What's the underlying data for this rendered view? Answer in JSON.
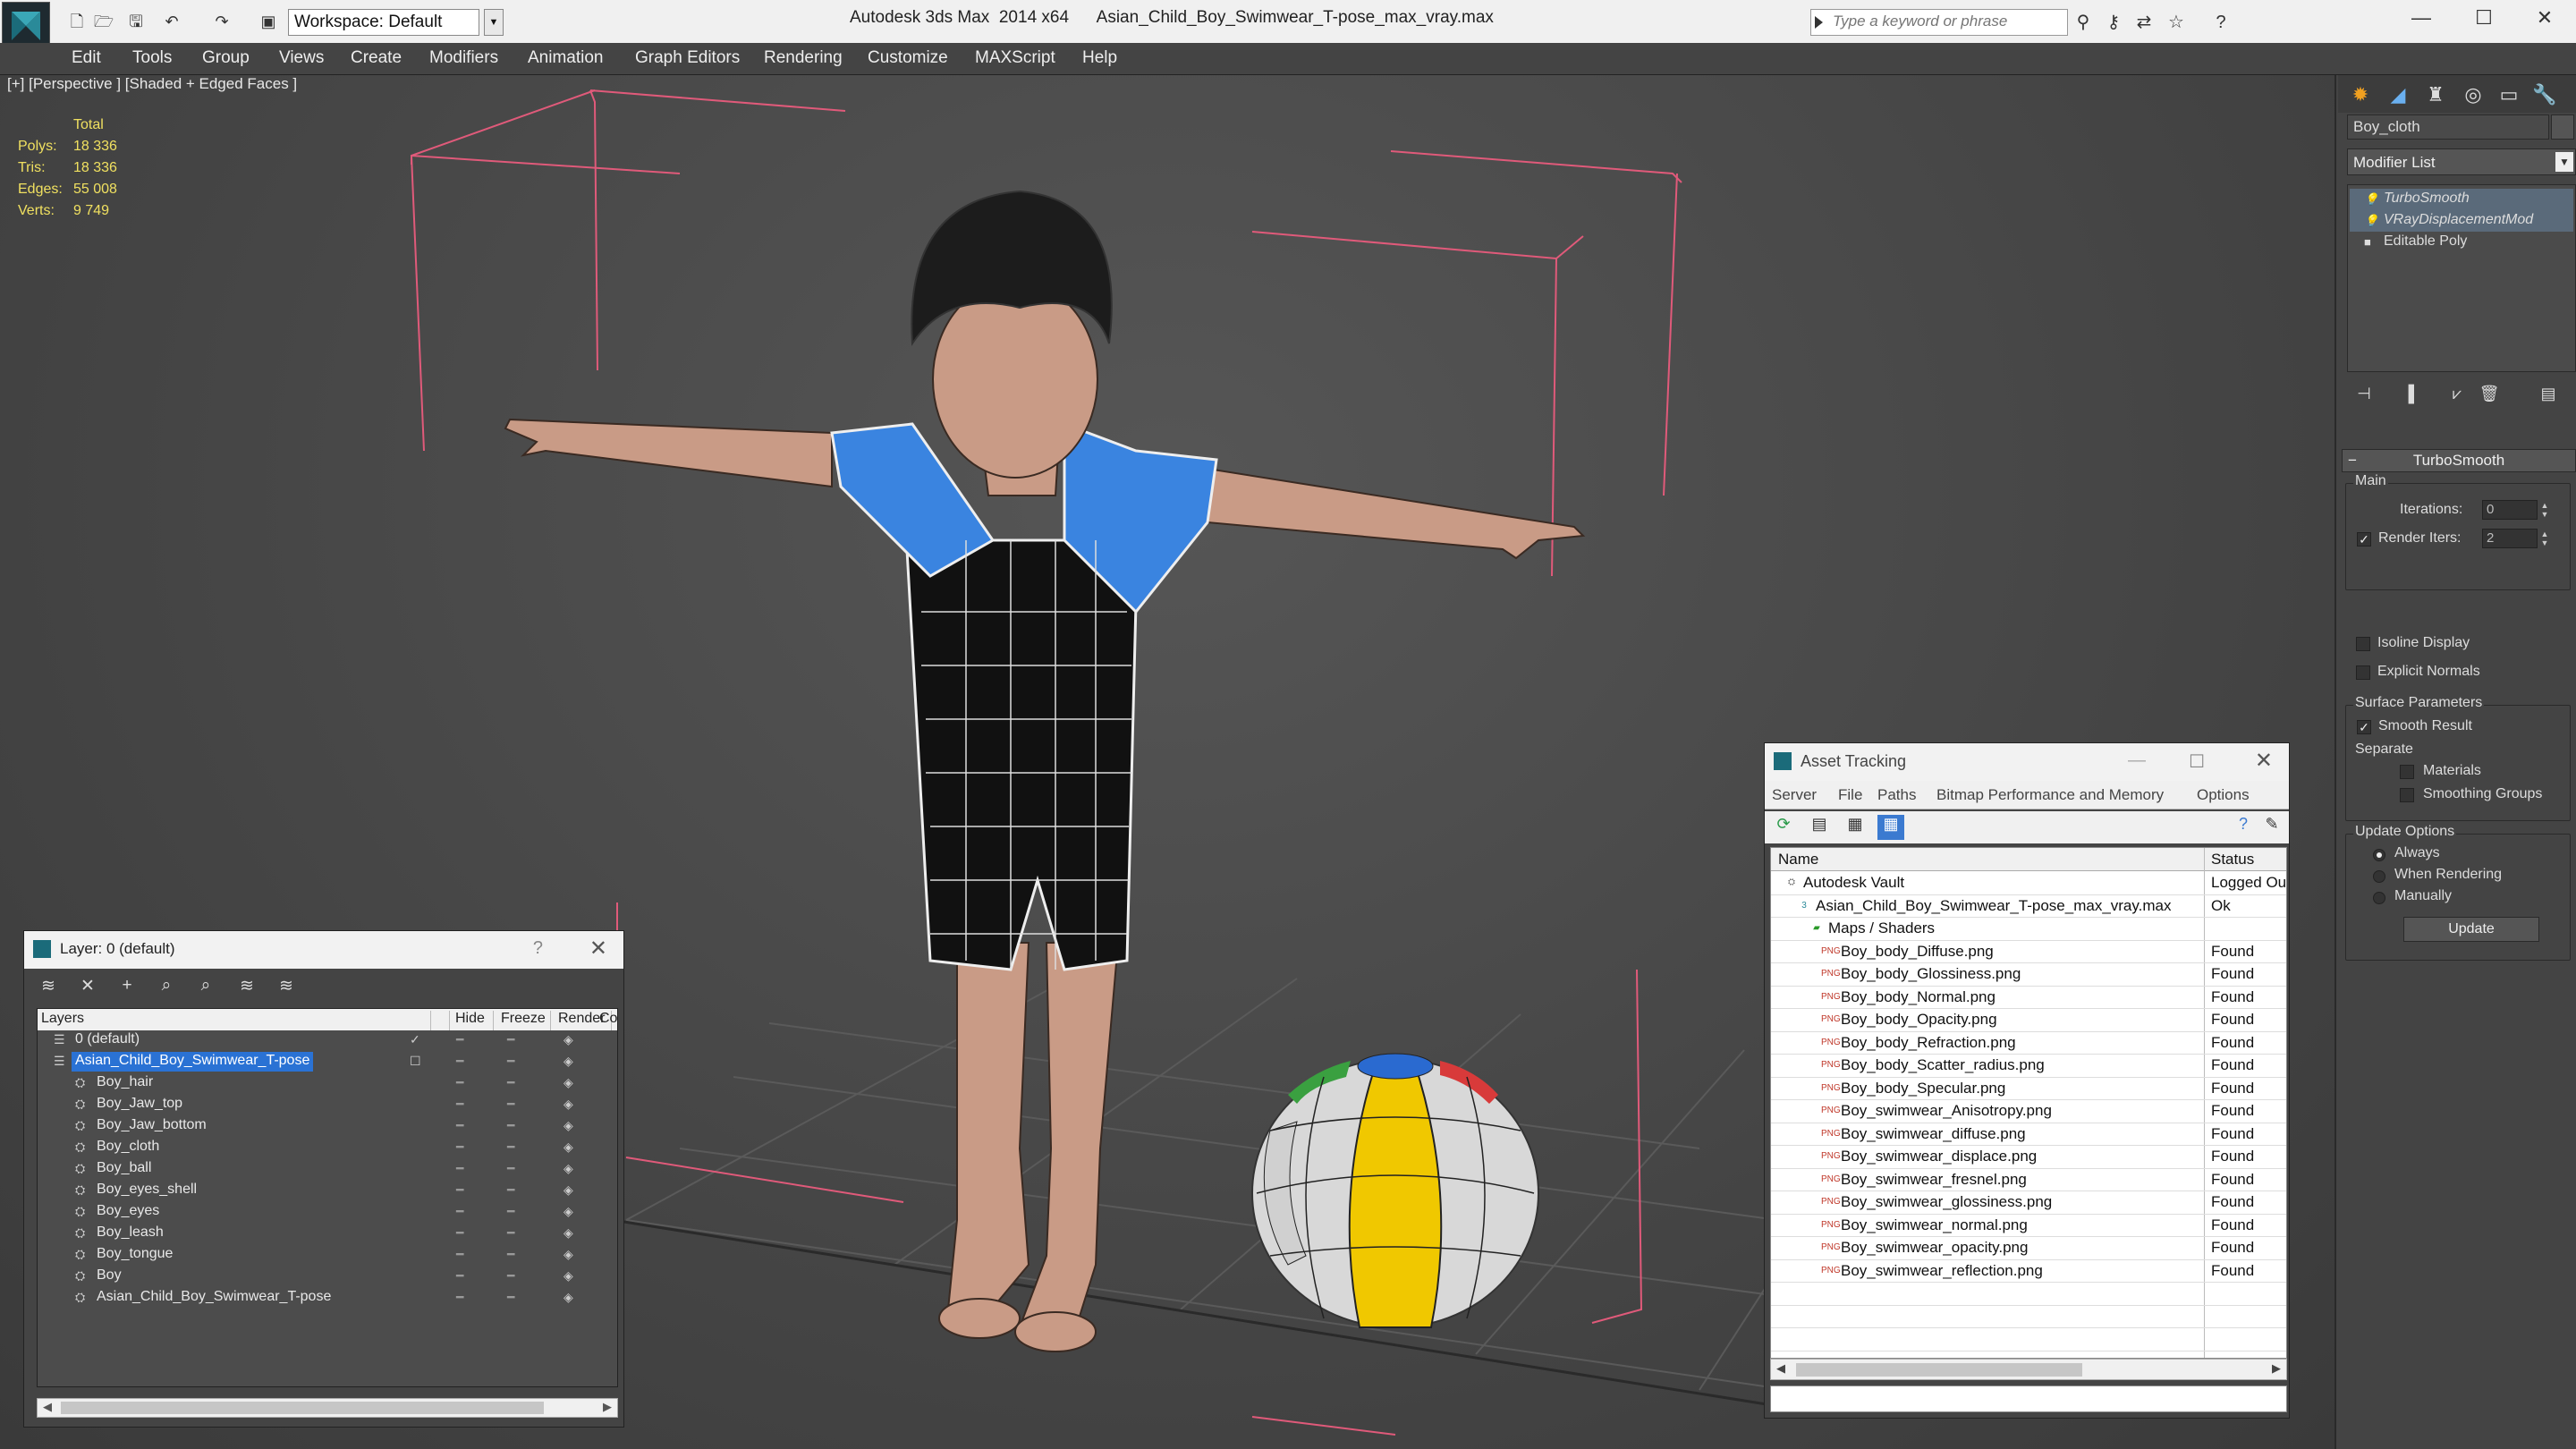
{
  "titlebar": {
    "workspace": "Workspace: Default",
    "app_title": "Autodesk 3ds Max  2014 x64      Asian_Child_Boy_Swimwear_T-pose_max_vray.max",
    "search_placeholder": "Type a keyword or phrase"
  },
  "menu": [
    "Edit",
    "Tools",
    "Group",
    "Views",
    "Create",
    "Modifiers",
    "Animation",
    "Graph Editors",
    "Rendering",
    "Customize",
    "MAXScript",
    "Help"
  ],
  "viewport": {
    "label": "[+] [Perspective ] [Shaded + Edged Faces ]",
    "stats_header": "Total",
    "stats": [
      {
        "k": "Polys:",
        "v": "18 336"
      },
      {
        "k": "Tris:",
        "v": "18 336"
      },
      {
        "k": "Edges:",
        "v": "55 008"
      },
      {
        "k": "Verts:",
        "v": "9 749"
      }
    ]
  },
  "command_panel": {
    "object_name": "Boy_cloth",
    "modifier_list": "Modifier List",
    "stack": [
      "TurboSmooth",
      "VRayDisplacementMod",
      "Editable Poly"
    ],
    "turbosmooth": {
      "title": "TurboSmooth",
      "main": "Main",
      "iterations_label": "Iterations:",
      "iterations": "0",
      "render_iters_label": "Render Iters:",
      "render_iters": "2",
      "isoline": "Isoline Display",
      "explicit_normals": "Explicit Normals",
      "surface_params": "Surface Parameters",
      "smooth_result": "Smooth Result",
      "separate": "Separate",
      "materials": "Materials",
      "smoothing_groups": "Smoothing Groups",
      "update_options": "Update Options",
      "always": "Always",
      "when_rendering": "When Rendering",
      "manually": "Manually",
      "update_button": "Update"
    }
  },
  "layer_dialog": {
    "title": "Layer: 0 (default)",
    "columns": [
      "Layers",
      "Hide",
      "Freeze",
      "Render",
      "Co"
    ],
    "rows": [
      {
        "name": "0 (default)",
        "level": 0
      },
      {
        "name": "Asian_Child_Boy_Swimwear_T-pose",
        "level": 0,
        "selected": true
      },
      {
        "name": "Boy_hair",
        "level": 1
      },
      {
        "name": "Boy_Jaw_top",
        "level": 1
      },
      {
        "name": "Boy_Jaw_bottom",
        "level": 1
      },
      {
        "name": "Boy_cloth",
        "level": 1
      },
      {
        "name": "Boy_ball",
        "level": 1
      },
      {
        "name": "Boy_eyes_shell",
        "level": 1
      },
      {
        "name": "Boy_eyes",
        "level": 1
      },
      {
        "name": "Boy_leash",
        "level": 1
      },
      {
        "name": "Boy_tongue",
        "level": 1
      },
      {
        "name": "Boy",
        "level": 1
      },
      {
        "name": "Asian_Child_Boy_Swimwear_T-pose",
        "level": 1
      }
    ]
  },
  "asset_dialog": {
    "title": "Asset Tracking",
    "menu": [
      "Server",
      "File",
      "Paths",
      "Bitmap Performance and Memory",
      "Options"
    ],
    "columns": [
      "Name",
      "Status"
    ],
    "rows": [
      {
        "name": "Autodesk Vault",
        "status": "Logged Ou",
        "level": 0,
        "icon": "vault"
      },
      {
        "name": "Asian_Child_Boy_Swimwear_T-pose_max_vray.max",
        "status": "Ok",
        "level": 1,
        "icon": "max"
      },
      {
        "name": "Maps / Shaders",
        "status": "",
        "level": 2,
        "icon": "folder"
      },
      {
        "name": "Boy_body_Diffuse.png",
        "status": "Found",
        "level": 3,
        "icon": "png"
      },
      {
        "name": "Boy_body_Glossiness.png",
        "status": "Found",
        "level": 3,
        "icon": "png"
      },
      {
        "name": "Boy_body_Normal.png",
        "status": "Found",
        "level": 3,
        "icon": "png"
      },
      {
        "name": "Boy_body_Opacity.png",
        "status": "Found",
        "level": 3,
        "icon": "png"
      },
      {
        "name": "Boy_body_Refraction.png",
        "status": "Found",
        "level": 3,
        "icon": "png"
      },
      {
        "name": "Boy_body_Scatter_radius.png",
        "status": "Found",
        "level": 3,
        "icon": "png"
      },
      {
        "name": "Boy_body_Specular.png",
        "status": "Found",
        "level": 3,
        "icon": "png"
      },
      {
        "name": "Boy_swimwear_Anisotropy.png",
        "status": "Found",
        "level": 3,
        "icon": "png"
      },
      {
        "name": "Boy_swimwear_diffuse.png",
        "status": "Found",
        "level": 3,
        "icon": "png"
      },
      {
        "name": "Boy_swimwear_displace.png",
        "status": "Found",
        "level": 3,
        "icon": "png"
      },
      {
        "name": "Boy_swimwear_fresnel.png",
        "status": "Found",
        "level": 3,
        "icon": "png"
      },
      {
        "name": "Boy_swimwear_glossiness.png",
        "status": "Found",
        "level": 3,
        "icon": "png"
      },
      {
        "name": "Boy_swimwear_normal.png",
        "status": "Found",
        "level": 3,
        "icon": "png"
      },
      {
        "name": "Boy_swimwear_opacity.png",
        "status": "Found",
        "level": 3,
        "icon": "png"
      },
      {
        "name": "Boy_swimwear_reflection.png",
        "status": "Found",
        "level": 3,
        "icon": "png"
      }
    ]
  },
  "colors": {
    "selection_blue": "#2a72d4",
    "swimwear_blue": "#3a84e0",
    "skin": "#c99b86",
    "ball_yellow": "#f0c800",
    "bbox_pink": "#e05a7a",
    "stats_yellow": "#f0e060"
  }
}
